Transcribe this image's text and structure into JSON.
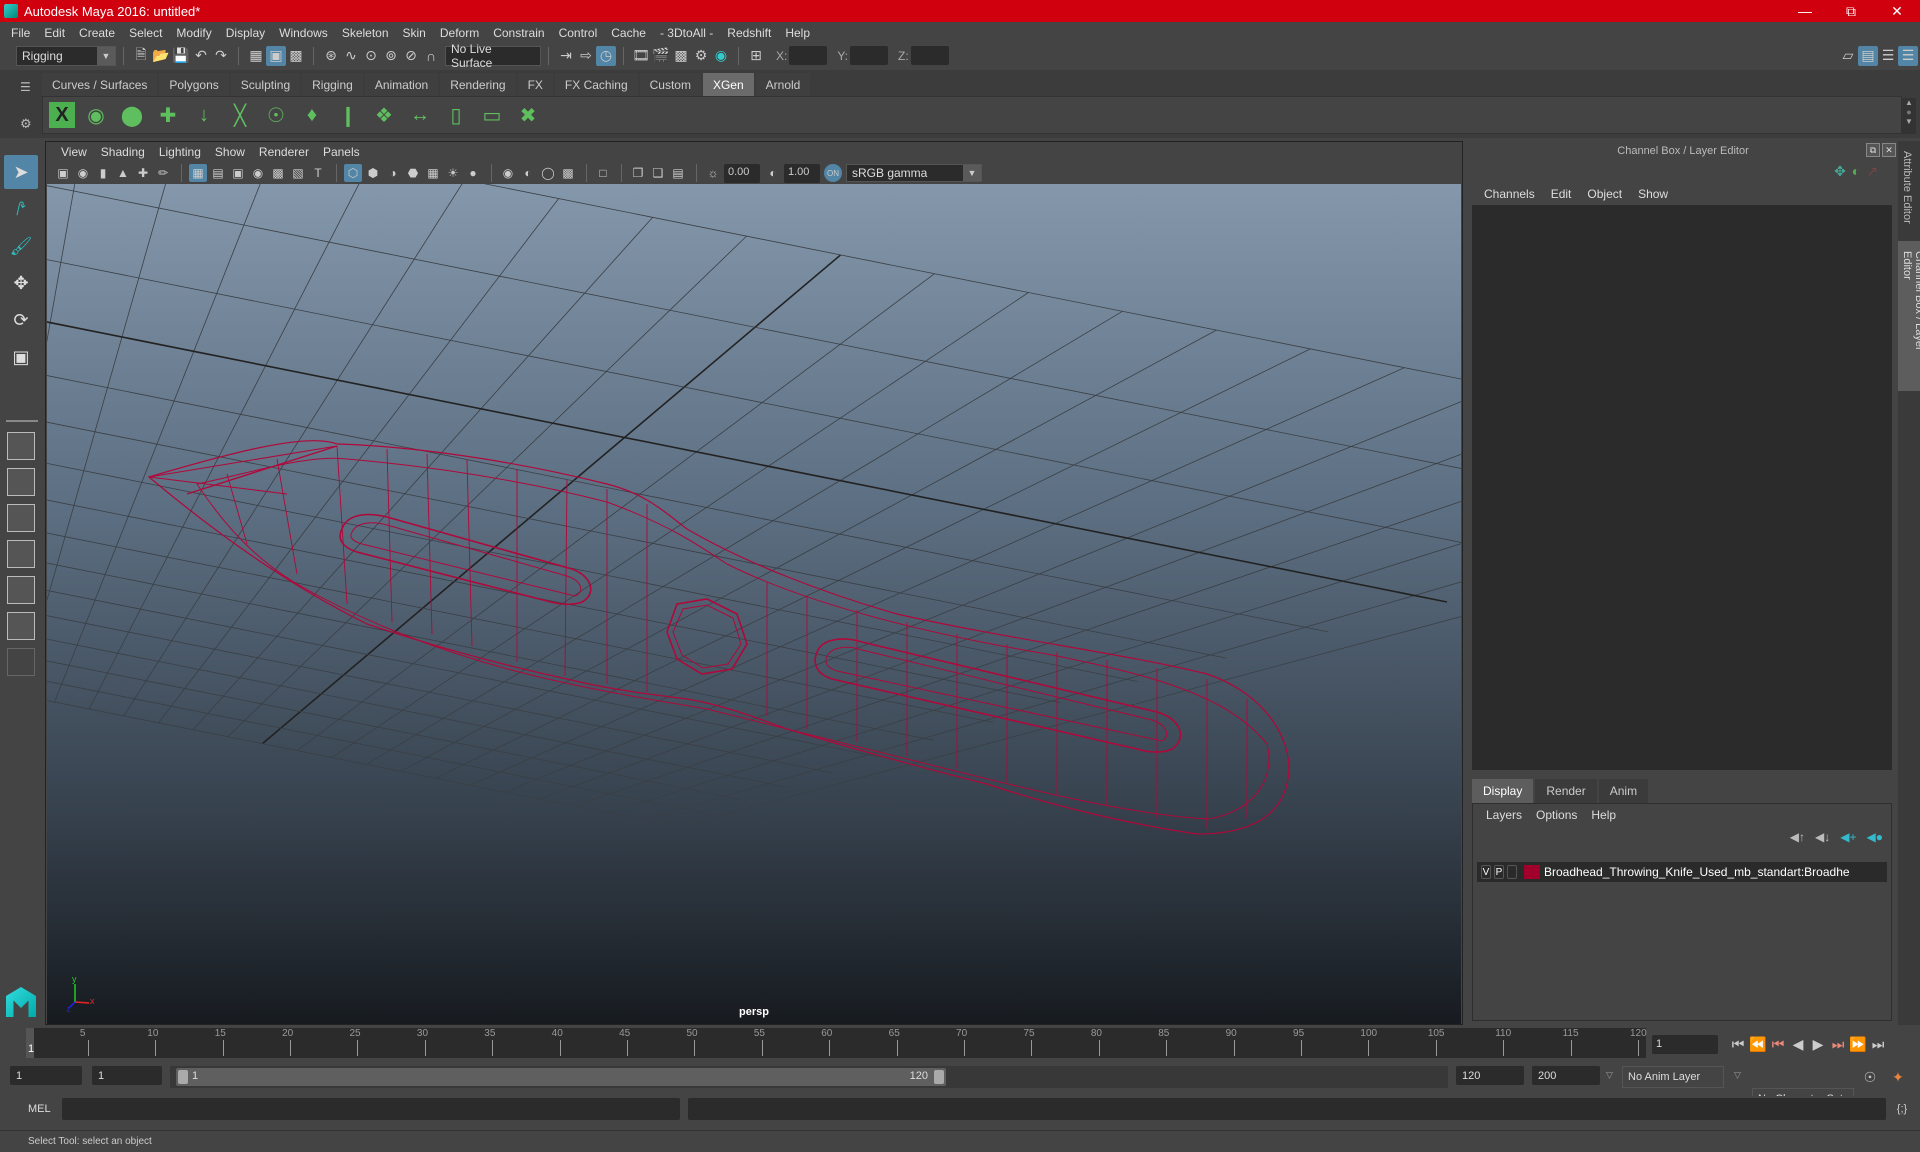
{
  "window": {
    "title": "Autodesk Maya 2016: untitled*",
    "controls": [
      "minimize",
      "restore",
      "close"
    ]
  },
  "menubar": [
    "File",
    "Edit",
    "Create",
    "Select",
    "Modify",
    "Display",
    "Windows",
    "Skeleton",
    "Skin",
    "Deform",
    "Constrain",
    "Control",
    "Cache",
    "- 3DtoAll -",
    "Redshift",
    "Help"
  ],
  "statusline": {
    "mode": "Rigging",
    "live_surface": "No Live Surface",
    "x_label": "X:",
    "y_label": "Y:",
    "z_label": "Z:",
    "x_value": "",
    "y_value": "",
    "z_value": ""
  },
  "shelf": {
    "tabs": [
      "Curves / Surfaces",
      "Polygons",
      "Sculpting",
      "Rigging",
      "Animation",
      "Rendering",
      "FX",
      "FX Caching",
      "Custom",
      "XGen",
      "Arnold"
    ],
    "active_tab": "XGen",
    "icons": [
      "xgen-editor-icon",
      "xgen-preview-icon",
      "xgen-clear-icon",
      "add-guides-icon",
      "move-guides-icon",
      "add-guide-icon",
      "show-guide-icon",
      "lock-guide-icon",
      "guide-length-icon",
      "guide-grid-icon",
      "interpolate-guides-icon",
      "select-guides-icon",
      "guide-box-icon",
      "delete-guides-icon"
    ]
  },
  "panel": {
    "menu": [
      "View",
      "Shading",
      "Lighting",
      "Show",
      "Renderer",
      "Panels"
    ],
    "exposure": "0.00",
    "gamma": "1.00",
    "color_space": "sRGB gamma",
    "camera_label": "persp"
  },
  "channel_box": {
    "header": "Channel Box / Layer Editor",
    "menu": [
      "Channels",
      "Edit",
      "Object",
      "Show"
    ]
  },
  "layer_editor": {
    "tabs": [
      "Display",
      "Render",
      "Anim"
    ],
    "active_tab": "Display",
    "menu": [
      "Layers",
      "Options",
      "Help"
    ],
    "layers": [
      {
        "v": "V",
        "p": "P",
        "color": "#a0002a",
        "name": "Broadhead_Throwing_Knife_Used_mb_standart:Broadhe"
      }
    ]
  },
  "side_tabs": [
    "Attribute Editor",
    "Channel Box / Layer Editor"
  ],
  "timeline": {
    "ticks": [
      5,
      10,
      15,
      20,
      25,
      30,
      35,
      40,
      45,
      50,
      55,
      60,
      65,
      70,
      75,
      80,
      85,
      90,
      95,
      100,
      105,
      110,
      115,
      120
    ],
    "current_frame_label": "1",
    "current_frame": "1",
    "start": 1,
    "end": 120
  },
  "range": {
    "start_time": "1",
    "playback_start": "1",
    "range_start_label": "1",
    "range_end_label": "120",
    "playback_end": "120",
    "end_time": "200",
    "anim_layer": "No Anim Layer",
    "character_set": "No Character Set"
  },
  "command_line": {
    "label": "MEL",
    "input": "",
    "output": ""
  },
  "help_line": "Select Tool: select an object",
  "colors": {
    "title_bar": "#d0000f",
    "accent": "#5285a6",
    "wireframe": "#b0083a",
    "layer_color": "#a0002a"
  }
}
